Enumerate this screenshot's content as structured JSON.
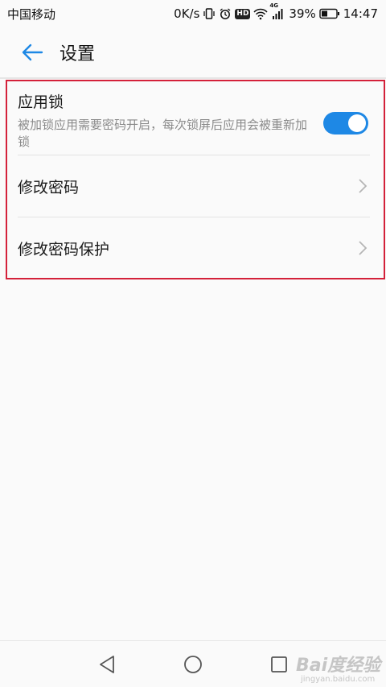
{
  "status_bar": {
    "carrier": "中国移动",
    "net_speed": "0K/s",
    "hd_label": "HD",
    "network_type": "4G",
    "battery_percent": "39%",
    "time": "14:47"
  },
  "header": {
    "title": "设置"
  },
  "settings": {
    "app_lock": {
      "title": "应用锁",
      "description": "被加锁应用需要密码开启，每次锁屏后应用会被重新加锁",
      "enabled": true,
      "accent_color": "#1e88e5"
    },
    "items": [
      {
        "label": "修改密码"
      },
      {
        "label": "修改密码保护"
      }
    ]
  },
  "highlight_color": "#d4213a",
  "watermark": {
    "main": "Bai度经验",
    "sub": "jingyan.baidu.com"
  }
}
